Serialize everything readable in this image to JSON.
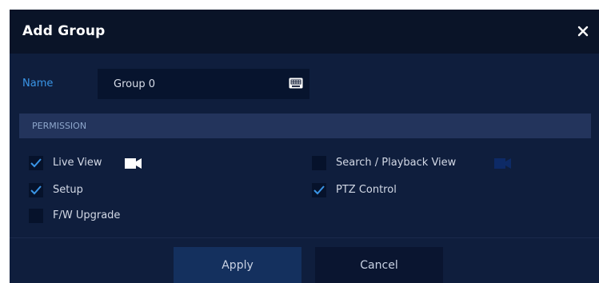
{
  "dialog": {
    "title": "Add Group",
    "close_icon": "close-icon"
  },
  "name_field": {
    "label": "Name",
    "value": "Group 0",
    "icon": "keyboard-icon"
  },
  "permission": {
    "header": "PERMISSION",
    "items": [
      {
        "label": "Live View",
        "checked": true,
        "icon": "camera-icon",
        "icon_color": "#ffffff"
      },
      {
        "label": "Search / Playback View",
        "checked": false,
        "icon": "camera-icon",
        "icon_color": "#0d2a66"
      },
      {
        "label": "Setup",
        "checked": true
      },
      {
        "label": "PTZ Control",
        "checked": true
      },
      {
        "label": "F/W Upgrade",
        "checked": false
      }
    ]
  },
  "buttons": {
    "apply": "Apply",
    "cancel": "Cancel"
  },
  "colors": {
    "dialog_bg": "#0f1e3d",
    "titlebar_bg": "#0a1428",
    "accent": "#3a95e6",
    "section_header_bg": "#23345c"
  }
}
